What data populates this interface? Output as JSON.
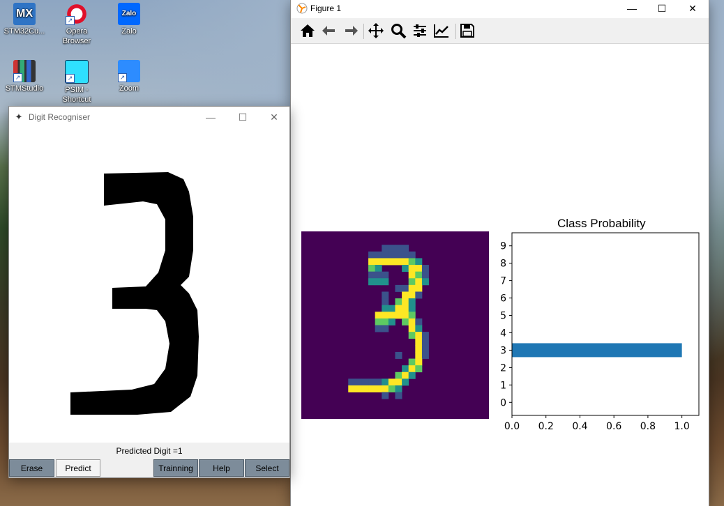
{
  "desktop": {
    "icons": [
      {
        "label": "STM32Cu...",
        "glyph": "MX"
      },
      {
        "label": "Opera Browser",
        "glyph": ""
      },
      {
        "label": "Zalo",
        "glyph": "Zalo"
      },
      {
        "label": "STMStudio",
        "glyph": ""
      },
      {
        "label": "PSIM - Shortcut",
        "glyph": ""
      },
      {
        "label": "Zoom",
        "glyph": ""
      }
    ]
  },
  "figure_window": {
    "title": "Figure 1",
    "toolbar": [
      "home-icon",
      "back-icon",
      "forward-icon",
      "pan-icon",
      "zoom-icon",
      "configure-subplots-icon",
      "edit-axis-icon",
      "save-icon"
    ]
  },
  "digit_window": {
    "title": "Digit Recogniser",
    "status": "Predicted Digit =1",
    "buttons": {
      "erase": "Erase",
      "predict": "Predict",
      "training": "Trainning",
      "help": "Help",
      "select": "Select"
    }
  },
  "chart_data": [
    {
      "type": "heatmap",
      "title": "",
      "description_digit": "3",
      "colormap": "viridis",
      "grid": false
    },
    {
      "type": "bar",
      "orientation": "horizontal",
      "title": "Class Probability",
      "categories": [
        "0",
        "1",
        "2",
        "3",
        "4",
        "5",
        "6",
        "7",
        "8",
        "9"
      ],
      "values": [
        0,
        0,
        0,
        1.0,
        0,
        0,
        0,
        0,
        0,
        0
      ],
      "xlim": [
        0,
        1.1
      ],
      "xticks": [
        "0.0",
        "0.2",
        "0.4",
        "0.6",
        "0.8",
        "1.0"
      ],
      "bar_color": "#1f77b4",
      "grid": false
    }
  ]
}
